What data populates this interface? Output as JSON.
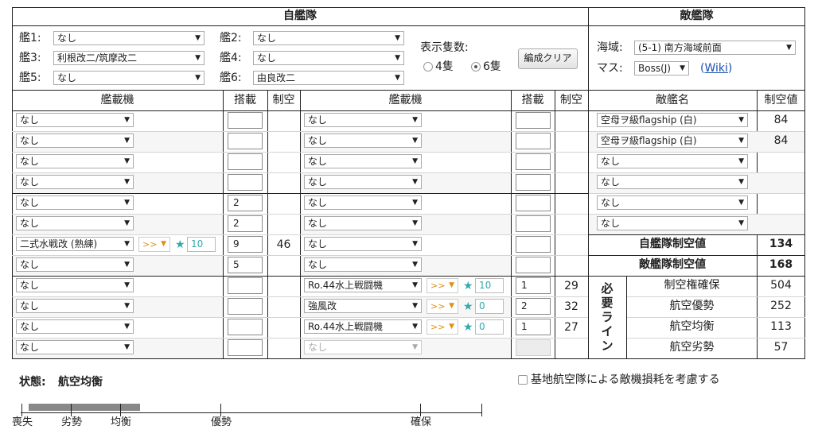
{
  "header": {
    "own_fleet": "自艦隊",
    "enemy_fleet": "敵艦隊"
  },
  "ships": [
    {
      "label": "艦1:",
      "value": "なし"
    },
    {
      "label": "艦2:",
      "value": "なし"
    },
    {
      "label": "艦3:",
      "value": "利根改二/筑摩改二"
    },
    {
      "label": "艦4:",
      "value": "なし"
    },
    {
      "label": "艦5:",
      "value": "なし"
    },
    {
      "label": "艦6:",
      "value": "由良改二"
    }
  ],
  "display_count": {
    "label": "表示隻数:",
    "option4": "4隻",
    "option6": "6隻",
    "selected": "6隻"
  },
  "clear_button": "編成クリア",
  "enemy": {
    "sea_label": "海域:",
    "sea_value": "(5-1) 南方海域前面",
    "cell_label": "マス:",
    "cell_value": "Boss(J)",
    "wiki_open": "(",
    "wiki_link": "Wiki",
    "wiki_close": ")"
  },
  "columns": {
    "equip": "艦載機",
    "slot": "搭載",
    "air": "制空",
    "enemy_name": "敵艦名",
    "enemy_air": "制空値"
  },
  "left_rows": [
    {
      "equip": "なし",
      "slot": "",
      "air": ""
    },
    {
      "equip": "なし",
      "slot": "",
      "air": ""
    },
    {
      "equip": "なし",
      "slot": "",
      "air": ""
    },
    {
      "equip": "なし",
      "slot": "",
      "air": ""
    },
    {
      "equip": "なし",
      "slot": "2",
      "air": ""
    },
    {
      "equip": "なし",
      "slot": "2",
      "air": ""
    },
    {
      "equip": "二式水戦改 (熟練)",
      "slot": "9",
      "air": "46",
      "prof": ">>",
      "improve": "10"
    },
    {
      "equip": "なし",
      "slot": "5",
      "air": ""
    },
    {
      "equip": "なし",
      "slot": "",
      "air": ""
    },
    {
      "equip": "なし",
      "slot": "",
      "air": ""
    },
    {
      "equip": "なし",
      "slot": "",
      "air": ""
    },
    {
      "equip": "なし",
      "slot": "",
      "air": ""
    }
  ],
  "mid_rows": [
    {
      "equip": "なし",
      "slot": "",
      "air": ""
    },
    {
      "equip": "なし",
      "slot": "",
      "air": ""
    },
    {
      "equip": "なし",
      "slot": "",
      "air": ""
    },
    {
      "equip": "なし",
      "slot": "",
      "air": ""
    },
    {
      "equip": "なし",
      "slot": "",
      "air": ""
    },
    {
      "equip": "なし",
      "slot": "",
      "air": ""
    },
    {
      "equip": "なし",
      "slot": "",
      "air": ""
    },
    {
      "equip": "なし",
      "slot": "",
      "air": ""
    },
    {
      "equip": "Ro.44水上戦闘機",
      "slot": "1",
      "air": "29",
      "prof": ">>",
      "improve": "10"
    },
    {
      "equip": "強風改",
      "slot": "2",
      "air": "32",
      "prof": ">>",
      "improve": "0"
    },
    {
      "equip": "Ro.44水上戦闘機",
      "slot": "1",
      "air": "27",
      "prof": ">>",
      "improve": "0"
    },
    {
      "equip": "なし",
      "slot": "",
      "air": "",
      "disabled": true
    }
  ],
  "enemy_rows": [
    {
      "name": "空母ヲ級flagship (白)",
      "air": "84"
    },
    {
      "name": "空母ヲ級flagship (白)",
      "air": "84"
    },
    {
      "name": "なし",
      "air": ""
    },
    {
      "name": "なし",
      "air": ""
    },
    {
      "name": "なし",
      "air": ""
    },
    {
      "name": "なし",
      "air": ""
    }
  ],
  "totals": {
    "own_label": "自艦隊制空値",
    "own_value": "134",
    "enemy_label": "敵艦隊制空値",
    "enemy_value": "168"
  },
  "required": {
    "title_chars": [
      "必",
      "要",
      "ラ",
      "イ",
      "ン"
    ],
    "rows": [
      {
        "label": "制空権確保",
        "value": "504"
      },
      {
        "label": "航空優勢",
        "value": "252"
      },
      {
        "label": "航空均衡",
        "value": "113"
      },
      {
        "label": "航空劣勢",
        "value": "57"
      }
    ]
  },
  "status": {
    "label": "状態:",
    "value": "航空均衡"
  },
  "base_air_checkbox": "基地航空隊による敵機損耗を考慮する",
  "gauge": {
    "level": 0.245,
    "ticks": [
      "喪失",
      "劣勢",
      "均衡",
      "優勢",
      "確保"
    ],
    "tick_positions": [
      0,
      0.11,
      0.22,
      0.44,
      0.88
    ]
  },
  "colors": {
    "gauge_fill": "#888888",
    "improve": "#33aaaa",
    "proficiency": "#e09010",
    "link": "#1a4fb0"
  }
}
